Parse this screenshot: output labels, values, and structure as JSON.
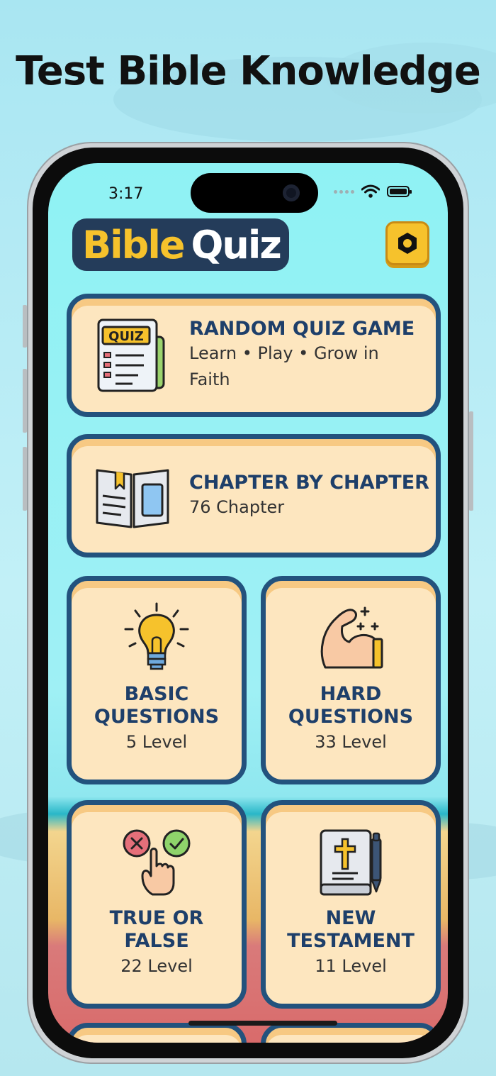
{
  "headline": "Test Bible Knowledge",
  "status": {
    "time": "3:17"
  },
  "header": {
    "logo_word1": "Bible",
    "logo_word2": "Quiz",
    "settings_icon": "gear-icon"
  },
  "cards": {
    "random": {
      "title": "RANDOM QUIZ GAME",
      "subtitle": "Learn • Play • Grow in Faith",
      "icon": "quiz-icon"
    },
    "chapter": {
      "title": "CHAPTER BY CHAPTER",
      "subtitle": "76 Chapter",
      "icon": "open-book-icon"
    },
    "basic": {
      "title_line1": "BASIC",
      "title_line2": "QUESTIONS",
      "subtitle": "5 Level",
      "icon": "lightbulb-icon"
    },
    "hard": {
      "title_line1": "HARD",
      "title_line2": "QUESTIONS",
      "subtitle": "33 Level",
      "icon": "muscle-icon"
    },
    "truefalse": {
      "title_line1": "TRUE OR",
      "title_line2": "FALSE",
      "subtitle": "22 Level",
      "icon": "true-false-icon"
    },
    "newtestament": {
      "title_line1": "NEW",
      "title_line2": "TESTAMENT",
      "subtitle": "11 Level",
      "icon": "bible-cross-icon"
    }
  },
  "colors": {
    "card_bg": "#fde6bf",
    "card_border": "#23527d",
    "title": "#1e3f6a",
    "logo_yellow": "#f6c22c",
    "logo_bg": "#243c5a"
  }
}
